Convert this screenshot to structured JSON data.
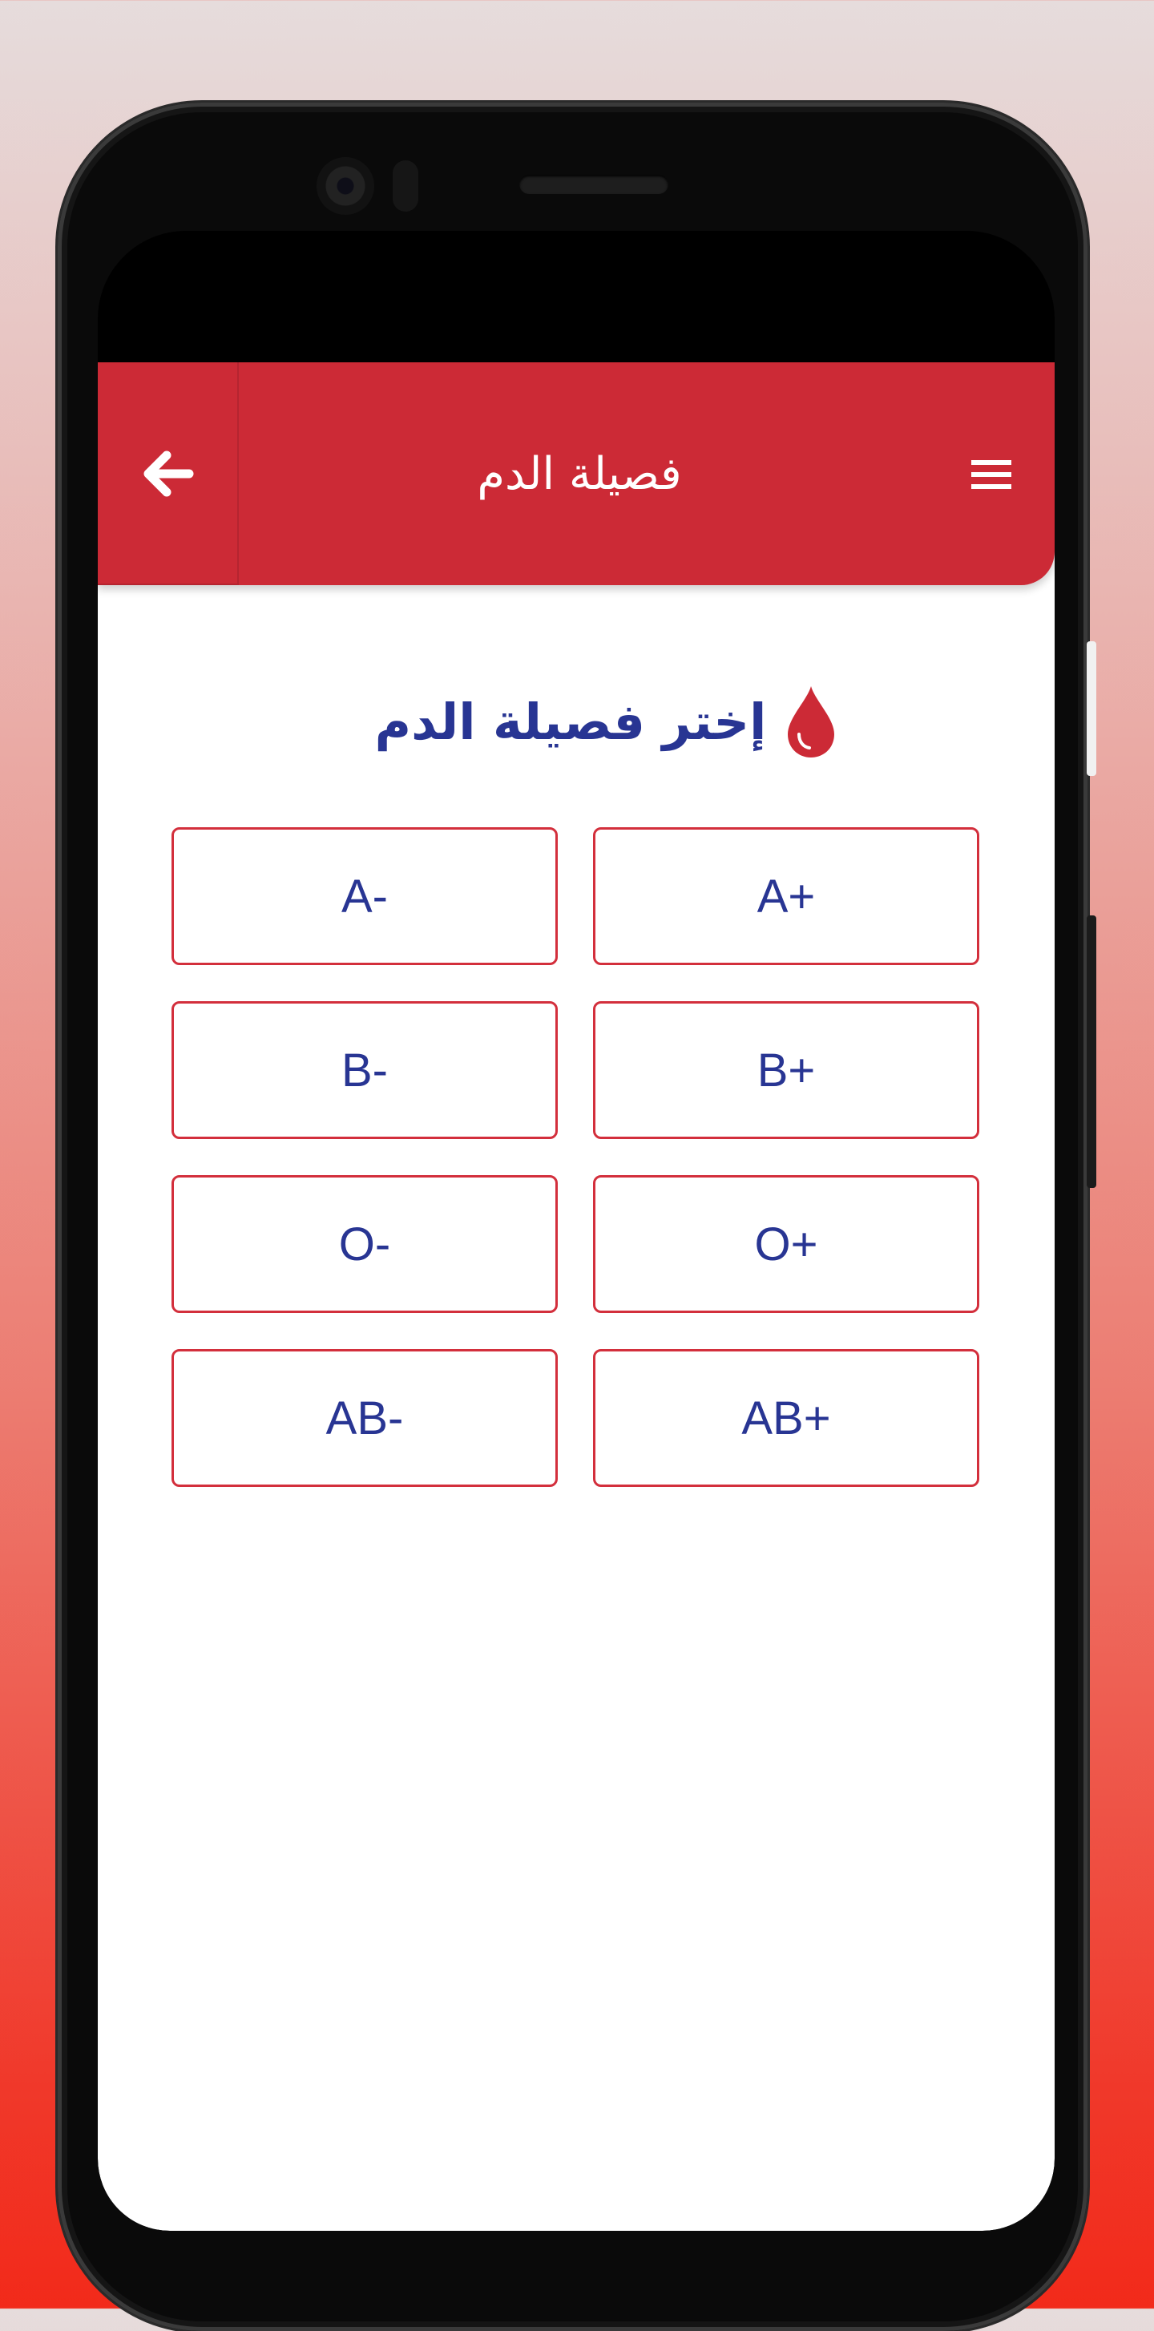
{
  "header": {
    "title": "فصيلة الدم",
    "back_icon": "arrow-left-icon",
    "menu_icon": "hamburger-menu-icon"
  },
  "content": {
    "prompt": "إختر فصيلة الدم",
    "prompt_icon": "blood-drop-icon"
  },
  "blood_types": [
    {
      "label": "A-"
    },
    {
      "label": "A+"
    },
    {
      "label": "B-"
    },
    {
      "label": "B+"
    },
    {
      "label": "O-"
    },
    {
      "label": "O+"
    },
    {
      "label": "AB-"
    },
    {
      "label": "AB+"
    }
  ],
  "colors": {
    "primary": "#cc2a36",
    "text_blue": "#283593",
    "border_red": "#d32f3c",
    "background_top": "#e6dcdc",
    "background_bottom": "#f22a1a"
  }
}
